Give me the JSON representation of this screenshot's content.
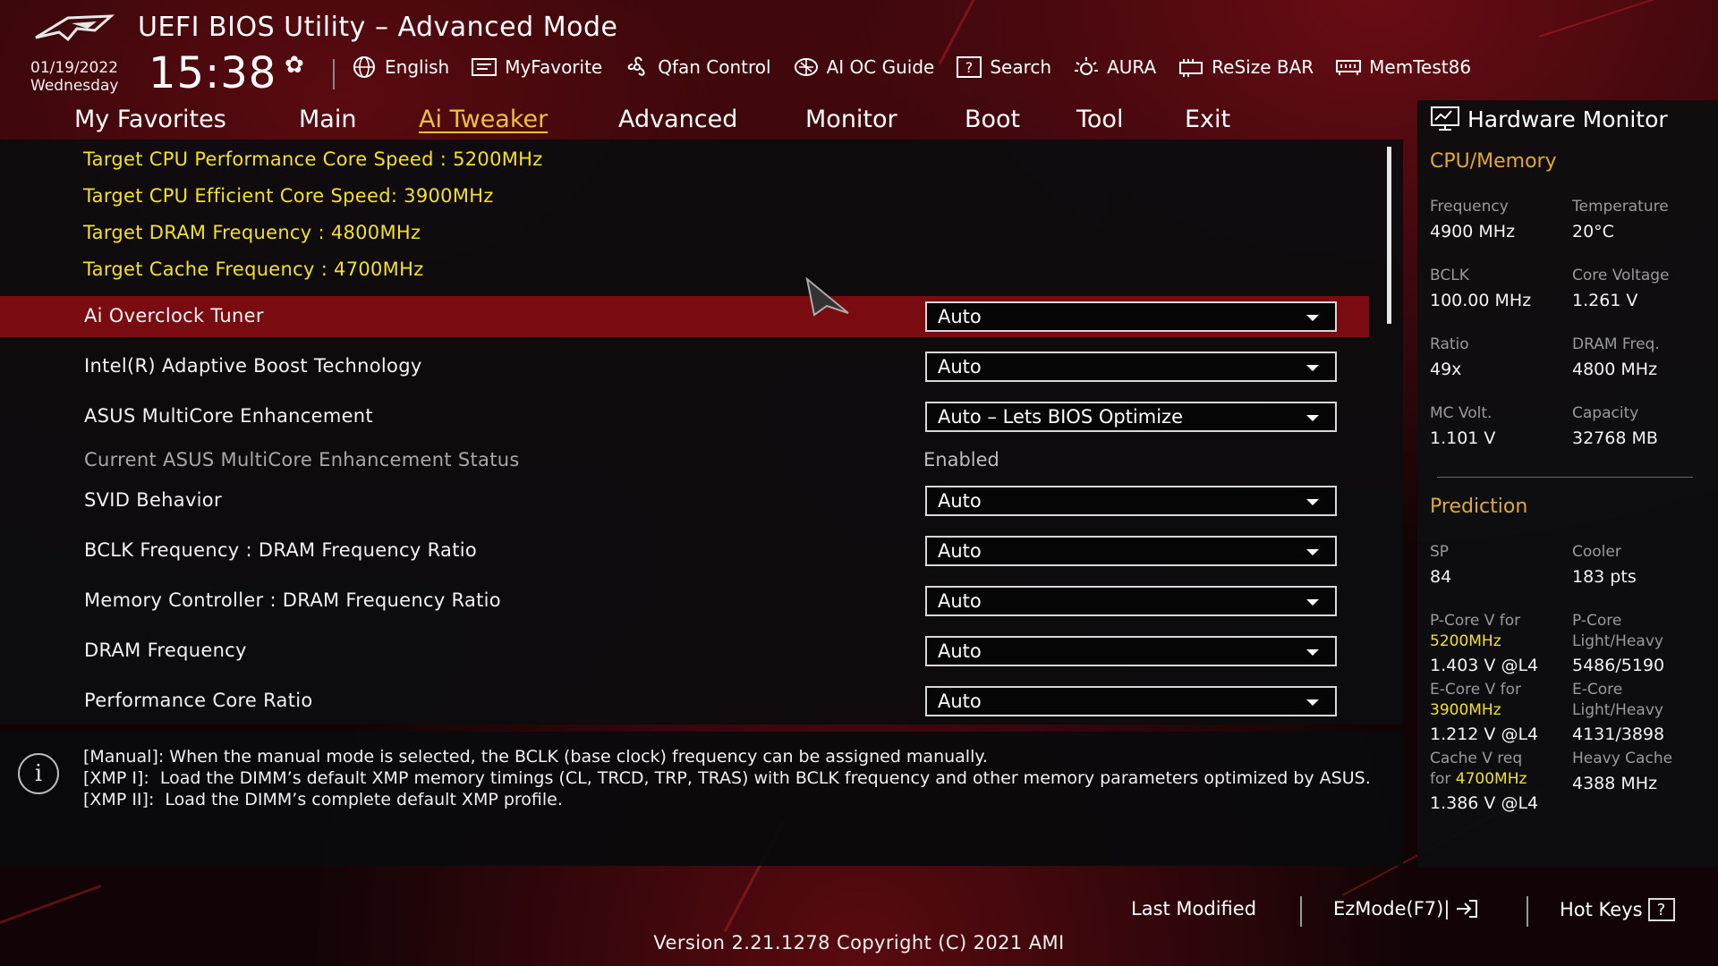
{
  "header": {
    "title": "UEFI BIOS Utility – Advanced Mode",
    "date": "01/19/2022",
    "weekday": "Wednesday",
    "time": "15:38",
    "icons": {
      "logo": "rog-logo",
      "settings": "gear-icon"
    }
  },
  "toolbar": {
    "items": [
      {
        "label": "English",
        "icon": "globe-icon"
      },
      {
        "label": "MyFavorite",
        "icon": "favorite-icon"
      },
      {
        "label": "Qfan Control",
        "icon": "fan-icon"
      },
      {
        "label": "AI OC Guide",
        "icon": "ai-oc-icon"
      },
      {
        "label": "Search",
        "icon": "search-icon"
      },
      {
        "label": "AURA",
        "icon": "aura-icon"
      },
      {
        "label": "ReSize BAR",
        "icon": "resize-bar-icon"
      },
      {
        "label": "MemTest86",
        "icon": "memtest-icon"
      }
    ]
  },
  "nav": {
    "tabs": [
      {
        "label": "My Favorites",
        "active": false
      },
      {
        "label": "Main",
        "active": false
      },
      {
        "label": "Ai Tweaker",
        "active": true
      },
      {
        "label": "Advanced",
        "active": false
      },
      {
        "label": "Monitor",
        "active": false
      },
      {
        "label": "Boot",
        "active": false
      },
      {
        "label": "Tool",
        "active": false
      },
      {
        "label": "Exit",
        "active": false
      }
    ]
  },
  "main": {
    "targets": [
      "Target CPU Performance Core Speed : 5200MHz",
      "Target CPU Efficient Core Speed: 3900MHz",
      "Target DRAM Frequency : 4800MHz",
      "Target Cache Frequency : 4700MHz"
    ],
    "settings": [
      {
        "label": "Ai Overclock Tuner",
        "value": "Auto",
        "type": "dropdown",
        "selected": true
      },
      {
        "label": "Intel(R) Adaptive Boost Technology",
        "value": "Auto",
        "type": "dropdown"
      },
      {
        "label": "ASUS MultiCore Enhancement",
        "value": "Auto – Lets BIOS Optimize",
        "type": "dropdown"
      },
      {
        "label": "Current ASUS MultiCore Enhancement Status",
        "value": "Enabled",
        "type": "static"
      },
      {
        "label": "SVID Behavior",
        "value": "Auto",
        "type": "dropdown"
      },
      {
        "label": "BCLK Frequency : DRAM Frequency Ratio",
        "value": "Auto",
        "type": "dropdown"
      },
      {
        "label": "Memory Controller : DRAM Frequency Ratio",
        "value": "Auto",
        "type": "dropdown"
      },
      {
        "label": "DRAM Frequency",
        "value": "Auto",
        "type": "dropdown"
      },
      {
        "label": "Performance Core Ratio",
        "value": "Auto",
        "type": "dropdown"
      }
    ]
  },
  "help": {
    "lines": [
      "[Manual]: When the manual mode is selected, the BCLK (base clock) frequency can be assigned manually.",
      "[XMP I]:  Load the DIMM’s default XMP memory timings (CL, TRCD, TRP, TRAS) with BCLK frequency and other memory parameters optimized by ASUS.",
      "[XMP II]:  Load the DIMM’s complete default XMP profile."
    ],
    "icon": "info-icon"
  },
  "hardware_monitor": {
    "title": "Hardware Monitor",
    "cpu_memory_title": "CPU/Memory",
    "cpu_memory": [
      {
        "label": "Frequency",
        "value": "4900 MHz"
      },
      {
        "label": "Temperature",
        "value": "20°C"
      },
      {
        "label": "BCLK",
        "value": "100.00 MHz"
      },
      {
        "label": "Core Voltage",
        "value": "1.261 V"
      },
      {
        "label": "Ratio",
        "value": "49x"
      },
      {
        "label": "DRAM Freq.",
        "value": "4800 MHz"
      },
      {
        "label": "MC Volt.",
        "value": "1.101 V"
      },
      {
        "label": "Capacity",
        "value": "32768 MB"
      }
    ],
    "prediction_title": "Prediction",
    "prediction": {
      "sp_label": "SP",
      "sp_value": "84",
      "cooler_label": "Cooler",
      "cooler_value": "183 pts",
      "pcore_v_label": "P-Core V for",
      "pcore_v_freq": "5200MHz",
      "pcore_v_value": "1.403 V @L4",
      "pcore_lh_label_1": "P-Core",
      "pcore_lh_label_2": "Light/Heavy",
      "pcore_lh_value": "5486/5190",
      "ecore_v_label": "E-Core V for",
      "ecore_v_freq": "3900MHz",
      "ecore_v_value": "1.212 V @L4",
      "ecore_lh_label_1": "E-Core",
      "ecore_lh_label_2": "Light/Heavy",
      "ecore_lh_value": "4131/3898",
      "cache_v_label_1": "Cache V req",
      "cache_v_label_2": "for",
      "cache_v_freq": "4700MHz",
      "cache_v_value": "1.386 V @L4",
      "heavy_cache_label": "Heavy Cache",
      "heavy_cache_value": "4388 MHz"
    }
  },
  "footer": {
    "last_modified": "Last Modified",
    "ezmode": "EzMode(F7)|",
    "hotkeys": "Hot Keys",
    "version": "Version 2.21.1278 Copyright (C) 2021 AMI"
  },
  "colors": {
    "accent_yellow": "#f2e02a",
    "selected_row": "#7a0c11",
    "section_orange": "#e0a838",
    "active_tab": "#e9c23f"
  }
}
